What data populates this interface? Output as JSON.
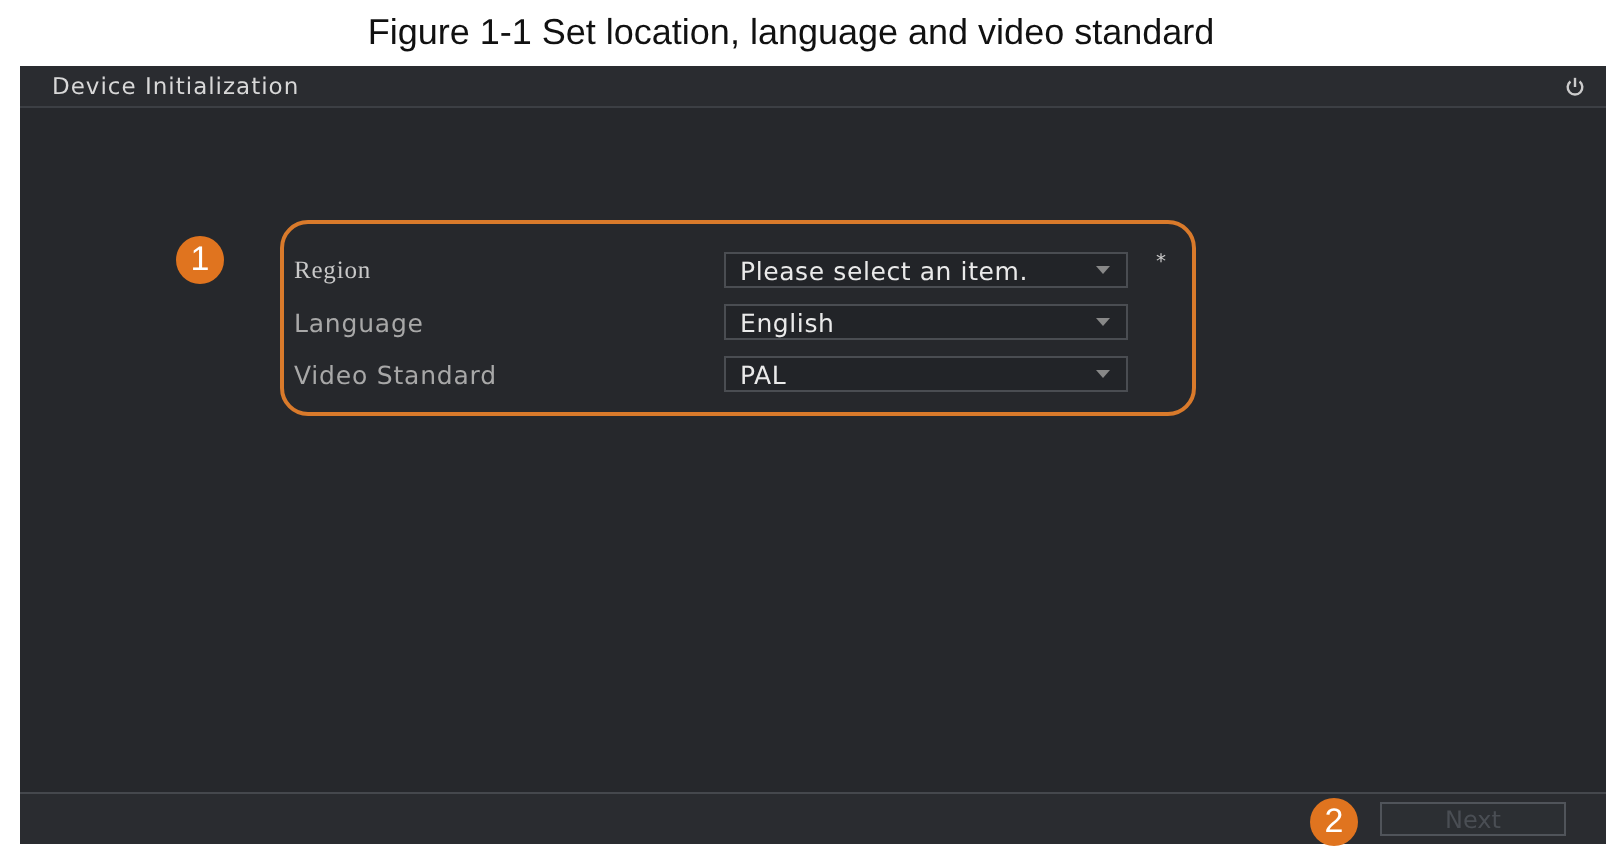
{
  "caption": "Figure 1-1 Set location, language and video standard",
  "window": {
    "title": "Device Initialization"
  },
  "form": {
    "callout": "1",
    "fields": [
      {
        "label": "Region",
        "value": "Please select an item.",
        "required_mark": "*"
      },
      {
        "label": "Language",
        "value": "English"
      },
      {
        "label": "Video Standard",
        "value": "PAL"
      }
    ]
  },
  "footer": {
    "callout": "2",
    "next_button": {
      "label": "Next",
      "disabled": true
    }
  }
}
